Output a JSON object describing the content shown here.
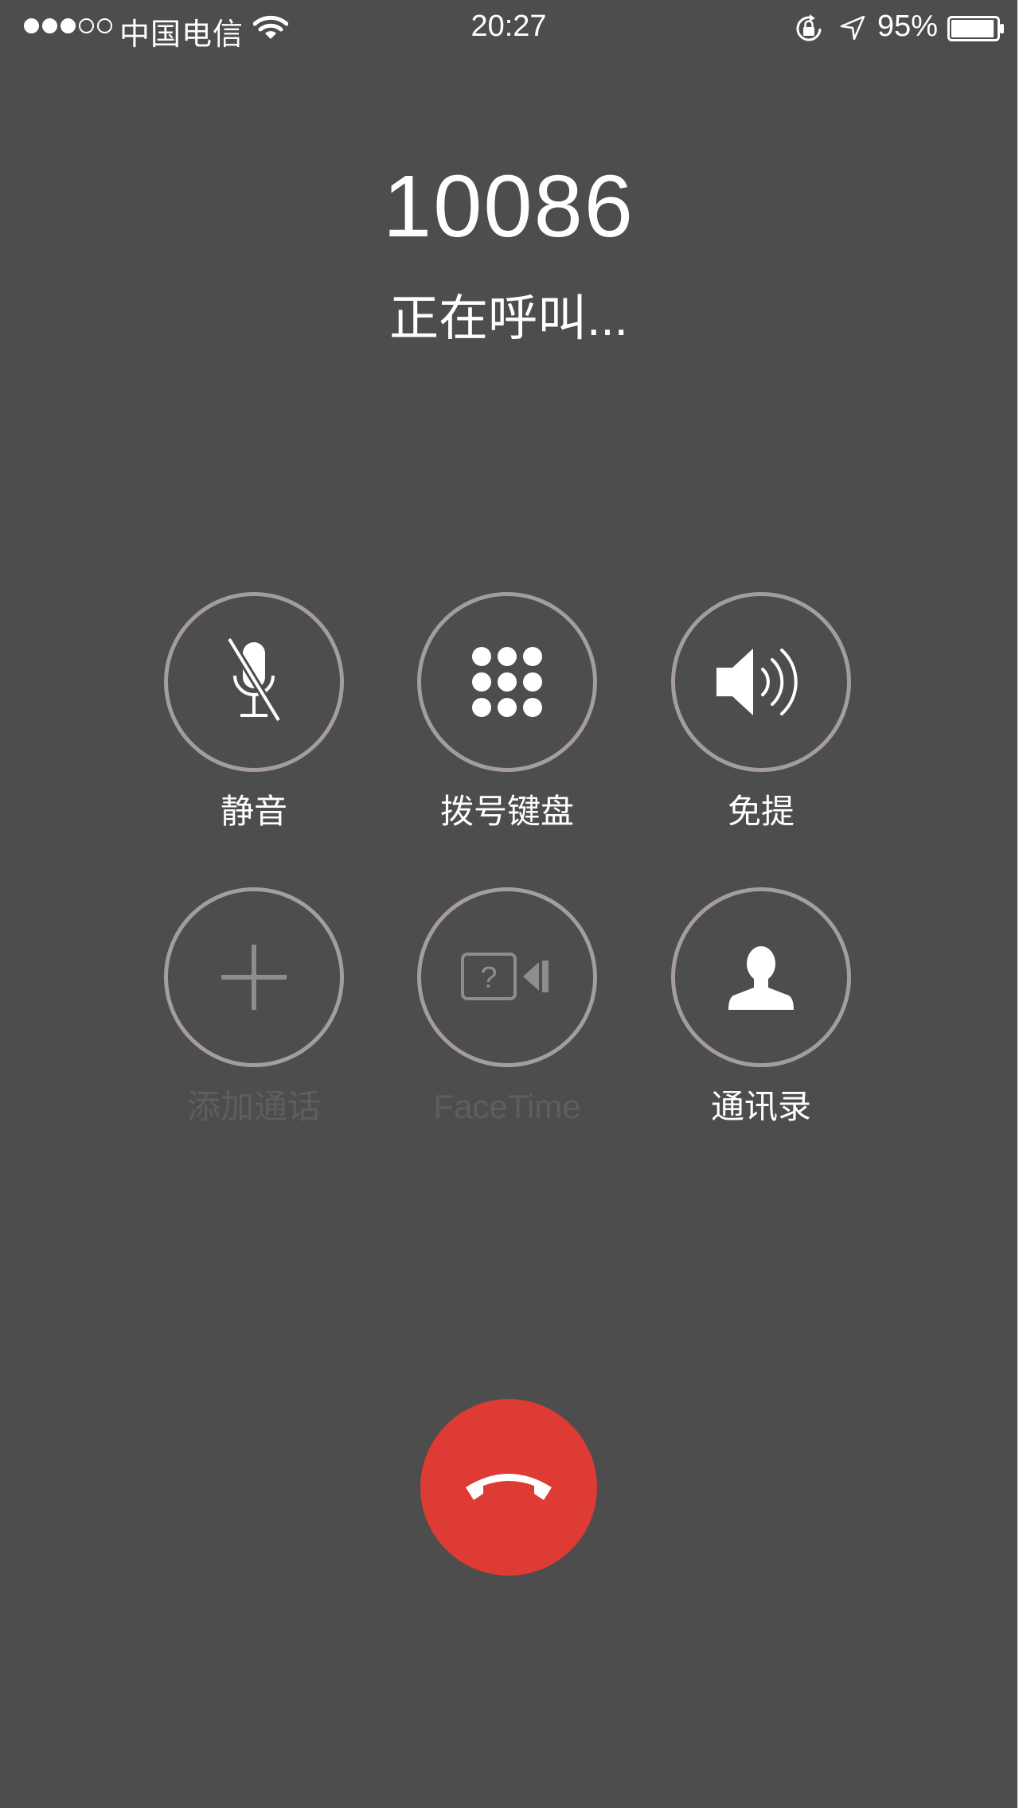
{
  "status_bar": {
    "signal_strength": 3,
    "signal_total": 5,
    "carrier": "中国电信",
    "wifi_icon": "wifi-icon",
    "time": "20:27",
    "rotation_lock_icon": "rotation-lock-icon",
    "location_icon": "location-arrow-icon",
    "battery_percent": "95%",
    "battery_level": 0.95
  },
  "call": {
    "number": "10086",
    "status": "正在呼叫..."
  },
  "controls": [
    {
      "id": "mute",
      "label": "静音",
      "icon": "muted-microphone-icon",
      "enabled": true
    },
    {
      "id": "keypad",
      "label": "拨号键盘",
      "icon": "keypad-icon",
      "enabled": true
    },
    {
      "id": "speaker",
      "label": "免提",
      "icon": "speaker-icon",
      "enabled": true
    },
    {
      "id": "add-call",
      "label": "添加通话",
      "icon": "plus-icon",
      "enabled": false
    },
    {
      "id": "facetime",
      "label": "FaceTime",
      "icon": "facetime-camera-icon",
      "enabled": false
    },
    {
      "id": "contacts",
      "label": "通讯录",
      "icon": "contact-person-icon",
      "enabled": true
    }
  ],
  "end_call": {
    "icon": "hang-up-phone-icon",
    "color": "#dd3b33"
  },
  "colors": {
    "background": "#4d4d4d",
    "button_ring": "#a49c9e",
    "disabled_text": "#5e5e5e",
    "text": "#ffffff"
  }
}
